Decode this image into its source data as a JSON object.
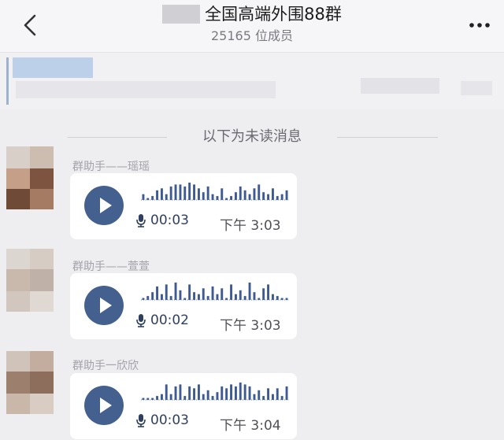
{
  "header": {
    "title": "全国高端外围88群",
    "member_count": "25165 位成员"
  },
  "divider": {
    "text": "以下为未读消息"
  },
  "messages": [
    {
      "sender": "群助手——瑶瑶",
      "duration": "00:03",
      "time": "下午  3:03"
    },
    {
      "sender": "群助手——萱萱",
      "duration": "00:02",
      "time": "下午  3:03"
    },
    {
      "sender": "群助手一欣欣",
      "duration": "00:03",
      "time": "下午  3:04"
    }
  ],
  "icons": {
    "back": "chevron-left-icon",
    "more": "more-icon",
    "play": "play-icon",
    "mic": "microphone-icon"
  },
  "colors": {
    "accent": "#44608f",
    "waveform": "#3d5a93"
  }
}
